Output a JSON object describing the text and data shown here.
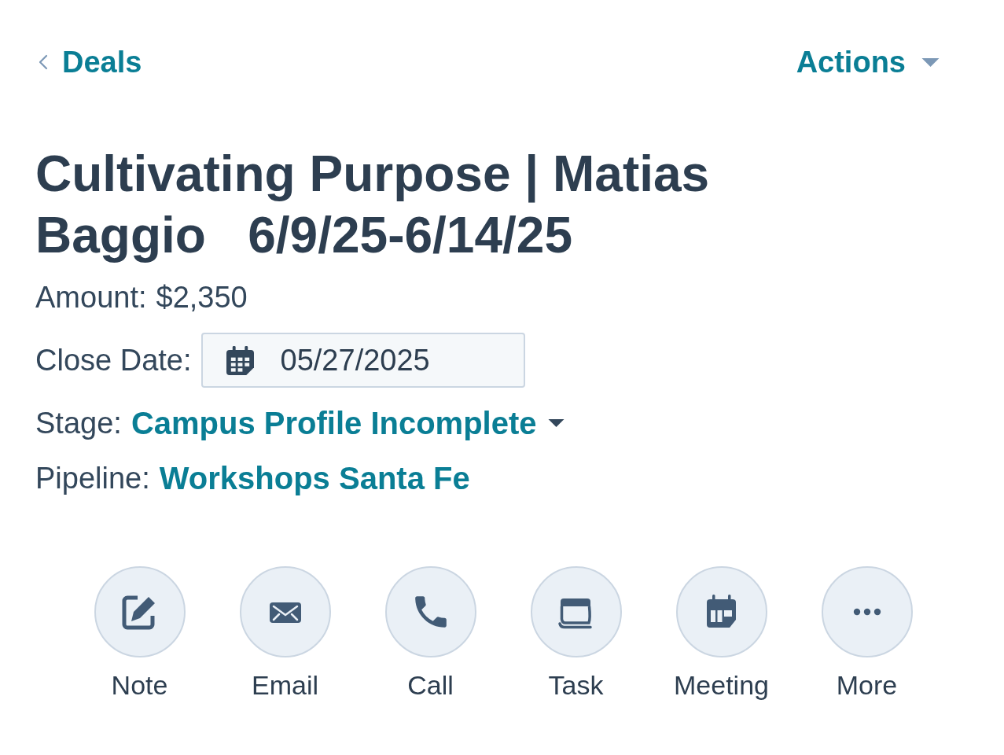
{
  "back_link": {
    "label": "Deals"
  },
  "actions_menu": {
    "label": "Actions"
  },
  "title": "Cultivating Purpose | Matias Baggio   6/9/25-6/14/25",
  "properties": [
    {
      "kind": "text",
      "label": "Amount:",
      "value": "$2,350"
    },
    {
      "kind": "date",
      "label": "Close Date:",
      "value": "05/27/2025"
    },
    {
      "kind": "dropdown",
      "label": "Stage:",
      "value": "Campus Profile Incomplete"
    },
    {
      "kind": "link",
      "label": "Pipeline:",
      "value": "Workshops Santa Fe"
    }
  ],
  "activity_buttons": [
    {
      "kind": "note",
      "label": "Note"
    },
    {
      "kind": "email",
      "label": "Email"
    },
    {
      "kind": "call",
      "label": "Call"
    },
    {
      "kind": "task",
      "label": "Task"
    },
    {
      "kind": "meeting",
      "label": "Meeting"
    },
    {
      "kind": "more",
      "label": "More"
    }
  ]
}
